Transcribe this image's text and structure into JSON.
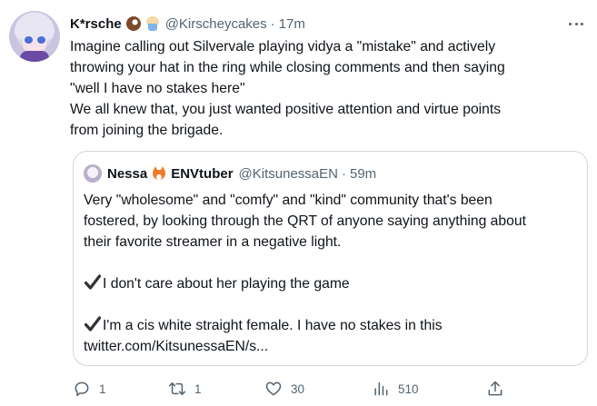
{
  "tweet": {
    "author": {
      "display_name": "K*rsche",
      "name_emojis": [
        "coconut-emoji",
        "cupcake-emoji"
      ],
      "handle": "@Kirscheycakes",
      "separator": "·",
      "time": "17m"
    },
    "text_lines": [
      "Imagine calling out Silvervale playing vidya a \"mistake\" and actively",
      "throwing your hat in the ring while closing comments and then saying",
      "\"well I have no stakes here\"",
      "We all knew that, you just wanted positive attention and virtue points",
      "from joining the brigade."
    ],
    "quote": {
      "display_name": "Nessa",
      "name_suffix": "ENVtuber",
      "name_emoji": "fox-emoji",
      "handle": "@KitsunessaEN",
      "separator": "·",
      "time": "59m",
      "text_lines": [
        "Very \"wholesome\" and \"comfy\" and \"kind\" community that's been",
        "fostered, by looking through the QRT of anyone saying anything about",
        "their favorite streamer in a negative light.",
        "",
        "I don't care about her playing the game",
        "",
        "I'm a cis white straight female. I have no stakes in this",
        "twitter.com/KitsunessaEN/s..."
      ]
    },
    "actions": {
      "replies": "1",
      "retweets": "1",
      "likes": "30",
      "views": "510"
    }
  },
  "colors": {
    "text_primary": "#0f1419",
    "text_secondary": "#536471",
    "border": "#cfd9de"
  }
}
